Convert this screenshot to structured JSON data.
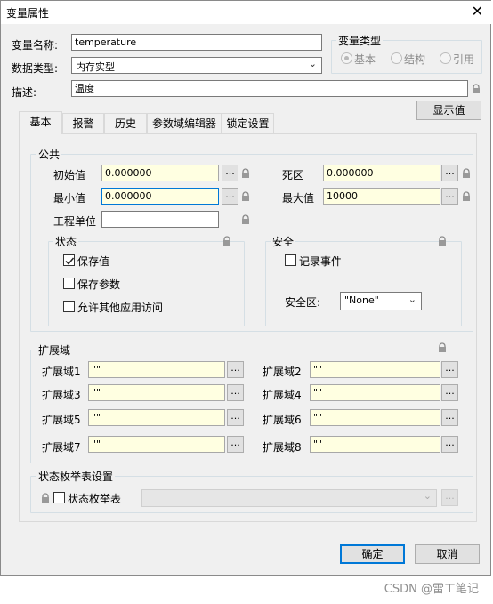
{
  "window": {
    "title": "变量属性",
    "close_icon": "close-icon"
  },
  "header": {
    "name_label": "变量名称:",
    "name_value": "temperature",
    "datatype_label": "数据类型:",
    "datatype_value": "内存实型",
    "desc_label": "描述:",
    "desc_value": "温度",
    "display_button": "显示值"
  },
  "var_type": {
    "title": "变量类型",
    "options": [
      "基本",
      "结构",
      "引用"
    ],
    "selected": "基本"
  },
  "tabs": [
    "基本",
    "报警",
    "历史",
    "参数域编辑器",
    "锁定设置"
  ],
  "common": {
    "title": "公共",
    "initial_label": "初始值",
    "initial_value": "0.000000",
    "deadband_label": "死区",
    "deadband_value": "0.000000",
    "min_label": "最小值",
    "min_value": "0.000000",
    "max_label": "最大值",
    "max_value": "10000",
    "unit_label": "工程单位",
    "unit_value": "",
    "dots": "..."
  },
  "state": {
    "title": "状态",
    "save_value": "保存值",
    "save_value_checked": true,
    "save_param": "保存参数",
    "allow_access": "允许其他应用访问"
  },
  "security": {
    "title": "安全",
    "log_event": "记录事件",
    "zone_label": "安全区:",
    "zone_value": "\"None\""
  },
  "extension": {
    "title": "扩展域",
    "fields": [
      {
        "label": "扩展域1",
        "value": "\"\""
      },
      {
        "label": "扩展域2",
        "value": "\"\""
      },
      {
        "label": "扩展域3",
        "value": "\"\""
      },
      {
        "label": "扩展域4",
        "value": "\"\""
      },
      {
        "label": "扩展域5",
        "value": "\"\""
      },
      {
        "label": "扩展域6",
        "value": "\"\""
      },
      {
        "label": "扩展域7",
        "value": "\"\""
      },
      {
        "label": "扩展域8",
        "value": "\"\""
      }
    ]
  },
  "enum": {
    "title": "状态枚举表设置",
    "checkbox_label": "状态枚举表"
  },
  "footer": {
    "ok": "确定",
    "cancel": "取消"
  },
  "watermark": "CSDN @雷工笔记"
}
